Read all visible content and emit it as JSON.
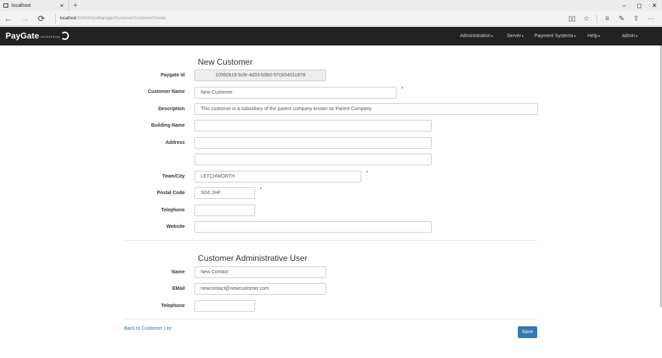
{
  "browser": {
    "tab_title": "localhost",
    "new_tab": "+",
    "url_host": "localhost",
    "url_path": ":52403/OpsManager/Customer/Customer/Create",
    "window_controls": [
      "–",
      "◻",
      "✕"
    ],
    "nav_icons": [
      "←",
      "→",
      "⟳"
    ],
    "tool_icons": [
      "reading-view-icon",
      "favorite-star-icon",
      "hub-icon",
      "web-note-icon",
      "share-icon",
      "more-icon"
    ]
  },
  "app": {
    "brand": "PayGate",
    "brand_sub": "ENTERPRISE",
    "menu": [
      {
        "label": "Administration"
      },
      {
        "label": "Server"
      },
      {
        "label": "Payment Systems"
      },
      {
        "label": "Help"
      },
      {
        "label": "admin"
      }
    ]
  },
  "form": {
    "title": "New Customer",
    "fields": {
      "paygate_id": {
        "label": "Paygate Id",
        "value": "10560b18-bcfe-4d33-b5b0-57cb5401c878"
      },
      "customer_name": {
        "label": "Customer Name",
        "value": "New Customer",
        "required": "*"
      },
      "description": {
        "label": "Description",
        "value": "This customer is a subsidiary of the parent company known as Parent Company."
      },
      "building_name": {
        "label": "Building Name",
        "value": ""
      },
      "address": {
        "label": "Address",
        "value": "",
        "value2": ""
      },
      "town_city": {
        "label": "Town/City",
        "value": "LETCHWORTH",
        "required": "*"
      },
      "postal_code": {
        "label": "Postal Code",
        "value": "SG6 2HF",
        "required": "*"
      },
      "telephone": {
        "label": "Telephone",
        "value": ""
      },
      "website": {
        "label": "Website",
        "value": ""
      }
    },
    "admin_title": "Customer Administrative User",
    "admin_fields": {
      "name": {
        "label": "Name",
        "value": "New Contact"
      },
      "email": {
        "label": "EMail",
        "value": "newcontact@newcustomer.com"
      },
      "telephone": {
        "label": "Telephone",
        "value": ""
      }
    },
    "back_link": "Back to Customer List",
    "save_label": "Save"
  },
  "colors": {
    "navbar_bg": "#222222",
    "primary": "#337ab7",
    "link": "#2a6fb5"
  }
}
